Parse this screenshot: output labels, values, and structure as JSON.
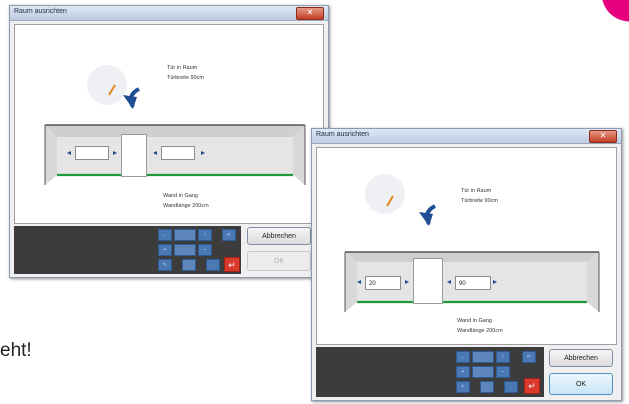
{
  "window_title": "Raum ausrichten",
  "close_glyph": "✕",
  "door_label": "Tür in Raum",
  "door_width": "Türbreite 90cm",
  "wall_label": "Wand in Gang",
  "wall_length": "Wandlänge 200cm",
  "keys": {
    "left": "←",
    "up": "↑",
    "enter": "↵",
    "plus": "+",
    "minus": "−",
    "diag": "↖",
    "dot": ".",
    "enter_red": "↵"
  },
  "buttons": {
    "cancel": "Abbrechen",
    "ok": "OK"
  },
  "window_back": {
    "left_field_value": "",
    "right_field_value": ""
  },
  "window_front": {
    "left_field_value": "20",
    "right_field_value": "90"
  },
  "document_text": "eht!",
  "colors": {
    "accent_pink": "#e6007e",
    "key_blue": "#4a78b3",
    "key_red": "#d93a2c",
    "floor_green": "#1f9a3a"
  }
}
